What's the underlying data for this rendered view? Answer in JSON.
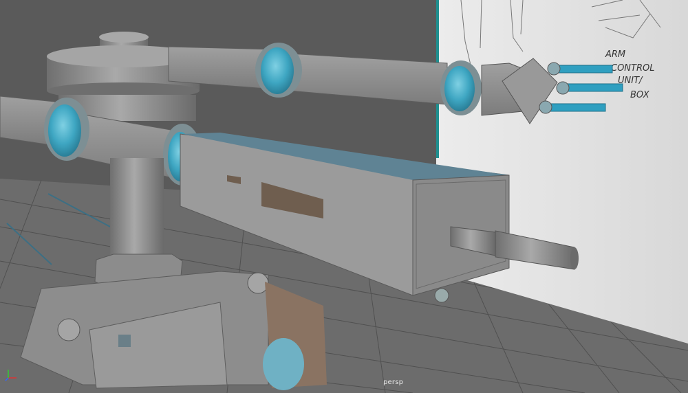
{
  "viewport": {
    "camera_label": "persp",
    "axis": {
      "x": "x",
      "y": "y",
      "z": "z"
    }
  },
  "reference_sketch": {
    "note_lines": [
      "ARM",
      "CONTROL",
      "UNIT/",
      "BOX"
    ]
  },
  "colors": {
    "viewport_bg": "#5a5a5a",
    "grid_floor": "#6e6e6e",
    "grid_line": "#4f4f4f",
    "model_gray": "#8c8c8c",
    "joint_cyan": "#3fa9c4",
    "accent_teal": "#1f8f8f",
    "panel_top": "#5f8394",
    "tread_brown": "#7a6a5a",
    "sketch_paper": "#e6e6e6"
  }
}
